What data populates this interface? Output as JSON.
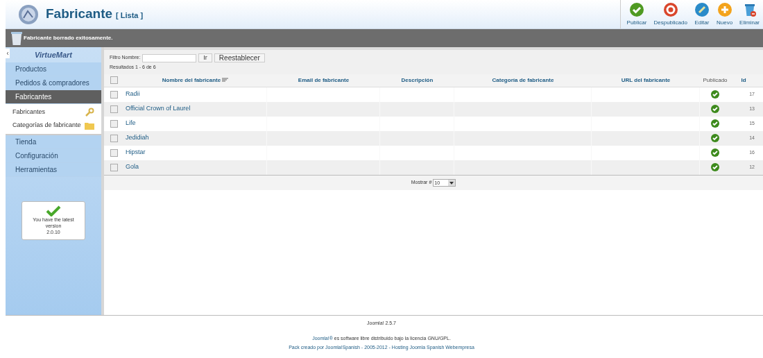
{
  "header": {
    "title": "Fabricante",
    "subtitle": "[ Lista ]"
  },
  "toolbar": [
    {
      "kind": "publish",
      "label": "Publicar"
    },
    {
      "kind": "unpublish",
      "label": "Despublicado"
    },
    {
      "kind": "edit",
      "label": "Editar"
    },
    {
      "kind": "new",
      "label": "Nuevo"
    },
    {
      "kind": "delete",
      "label": "Eliminar"
    }
  ],
  "message": "Fabricante borrado exitosamente.",
  "sidebar": {
    "logo": "VirtueMart",
    "items": [
      {
        "label": "Productos",
        "selected": false
      },
      {
        "label": "Pedidos & compradores",
        "selected": false
      },
      {
        "label": "Fabricantes",
        "selected": true,
        "children": [
          {
            "label": "Fabricantes",
            "kind": "wrench"
          },
          {
            "label": "Categorías de fabricante",
            "kind": "folder"
          }
        ]
      },
      {
        "label": "Tienda",
        "selected": false
      },
      {
        "label": "Configuración",
        "selected": false
      },
      {
        "label": "Herramientas",
        "selected": false
      }
    ],
    "version_box": {
      "text": "You have the latest version",
      "version": "2.0.10"
    }
  },
  "filter": {
    "label": "Filtro Nombre:",
    "go": "Ir",
    "reset": "Reestablecer",
    "results": "Resultados 1 - 6 de 6"
  },
  "table": {
    "all_checked": false,
    "columns": [
      "Nombre del fabricante",
      "Email de fabricante",
      "Descripción",
      "Categoría de fabricante",
      "URL del fabricante",
      "Publicado",
      "Id"
    ],
    "rows": [
      {
        "name": "Radii",
        "checked": false,
        "published": true,
        "id": "17"
      },
      {
        "name": "Official Crown of Laurel",
        "checked": false,
        "published": true,
        "id": "13"
      },
      {
        "name": "Life",
        "checked": false,
        "published": true,
        "id": "15"
      },
      {
        "name": "Jedidiah",
        "checked": false,
        "published": true,
        "id": "14"
      },
      {
        "name": "Hipstar",
        "checked": false,
        "published": true,
        "id": "16"
      },
      {
        "name": "Gola",
        "checked": false,
        "published": true,
        "id": "12"
      }
    ]
  },
  "pagination": {
    "label": "Mostrar #",
    "value": "10"
  },
  "footer": {
    "version": "Joomla! 2.5.7",
    "license_link": "Joomla!®",
    "license_text": "es software libre distribuido bajo la licencia GNU/GPL.",
    "credits": "Pack creado por Joomla!Spanish - 2005-2012 - Hosting Joomla Spanish Webempresa"
  }
}
